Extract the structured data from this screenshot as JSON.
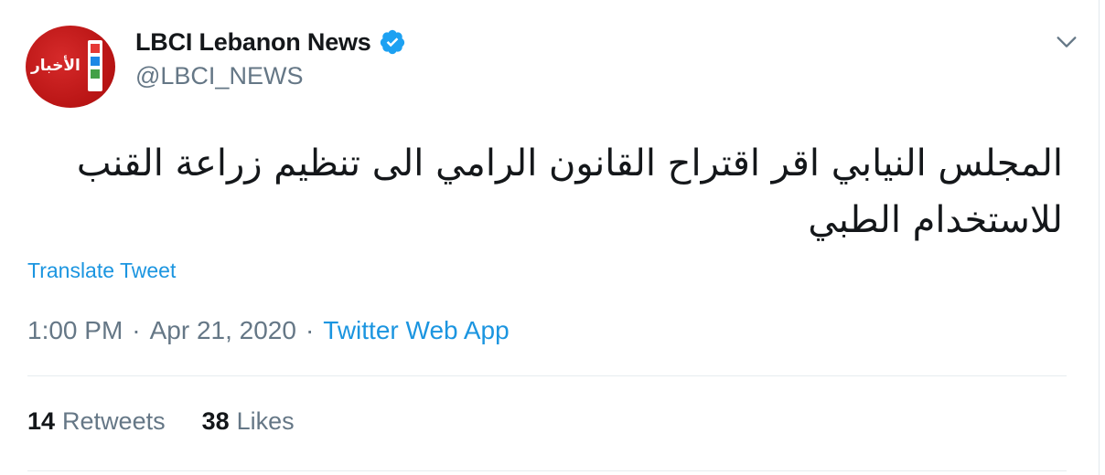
{
  "tweet": {
    "author": {
      "display_name": "LBCI Lebanon News",
      "handle": "@LBCI_NEWS",
      "avatar_text": "الأخبار",
      "verified": true,
      "verified_icon": "verified-badge-icon"
    },
    "text": "المجلس النيابي اقر اقتراح القانون الرامي الى تنظيم زراعة القنب للاستخدام الطبي",
    "translate_label": "Translate Tweet",
    "time": "1:00 PM",
    "date": "Apr 21, 2020",
    "separator": "·",
    "source": "Twitter Web App",
    "stats": {
      "retweets_count": "14",
      "retweets_label": "Retweets",
      "likes_count": "38",
      "likes_label": "Likes"
    }
  },
  "colors": {
    "link": "#1b95e0",
    "secondary_text": "#657786",
    "primary_text": "#14171a",
    "avatar_red": "#c41a1a",
    "divider": "#e6ecf0"
  }
}
